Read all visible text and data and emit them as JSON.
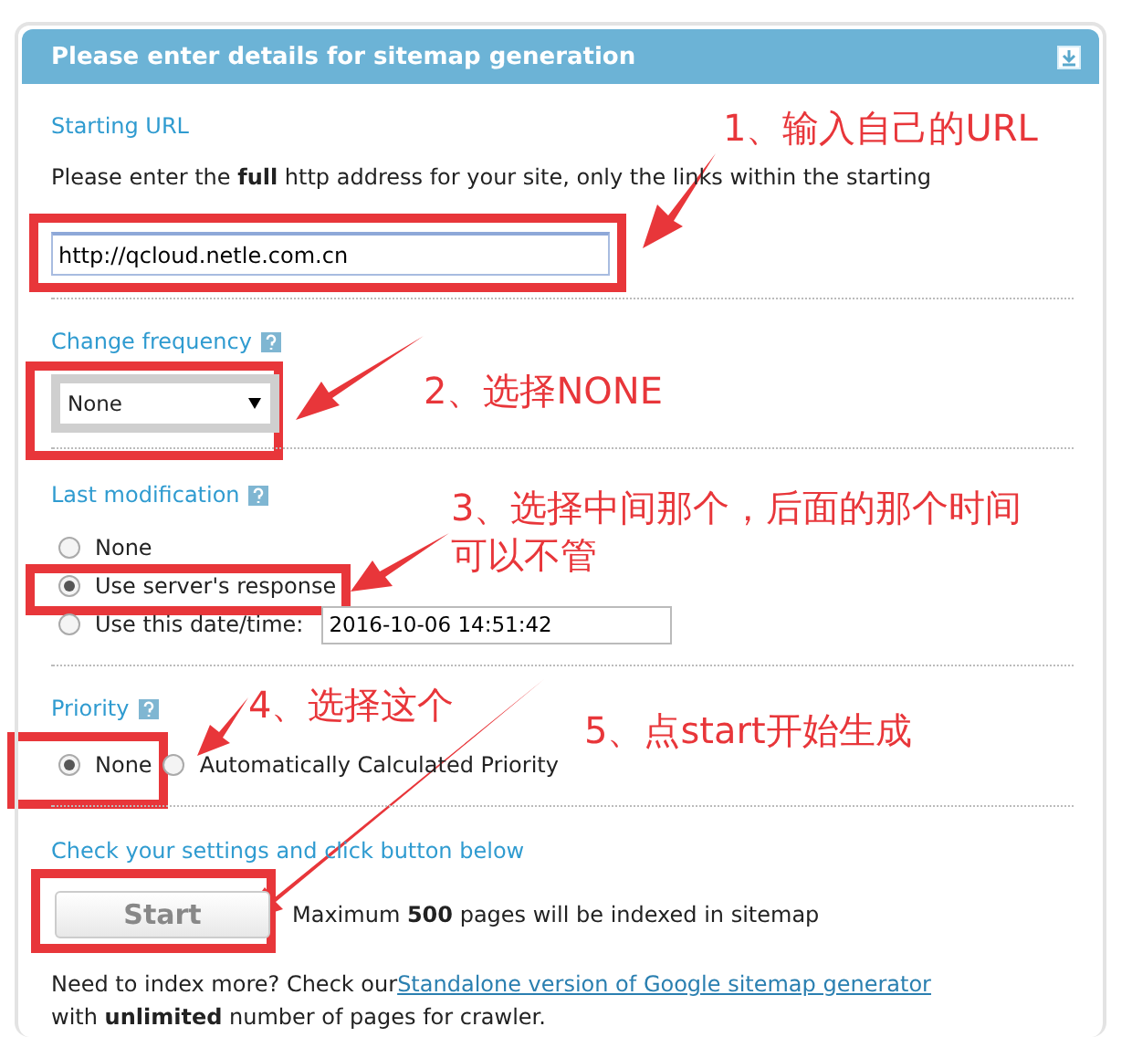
{
  "panel": {
    "title": "Please enter details for sitemap generation"
  },
  "starting_url": {
    "label": "Starting URL",
    "description": "Please enter the **full** http address for your site, only the links within the starting",
    "value": "http://qcloud.netle.com.cn"
  },
  "change_frequency": {
    "label": "Change frequency",
    "value": "None"
  },
  "last_modification": {
    "label": "Last modification",
    "options": [
      {
        "label": "None",
        "selected": false
      },
      {
        "label": "Use server's response",
        "selected": true
      },
      {
        "label": "Use this date/time:",
        "selected": false
      }
    ],
    "date_value": "2016-10-06 14:51:42"
  },
  "priority": {
    "label": "Priority",
    "options": [
      {
        "label": "None",
        "selected": true
      },
      {
        "label": "Automatically Calculated Priority",
        "selected": false
      }
    ]
  },
  "submit": {
    "heading": "Check your settings and click button below",
    "button": "Start",
    "note": "Maximum **500** pages will be indexed in sitemap"
  },
  "footer": {
    "text_before": "Need to index more? Check our",
    "link": "Standalone version of Google sitemap generator",
    "text_after": "with **unlimited** number of pages for crawler."
  },
  "annotations": [
    {
      "text": "1、输入自己的URL"
    },
    {
      "text": "2、选择NONE"
    },
    {
      "text": "3、选择中间那个，后面的那个时间"
    },
    {
      "text": "可以不管"
    },
    {
      "text": "4、选择这个"
    },
    {
      "text": "5、点start开始生成"
    }
  ]
}
